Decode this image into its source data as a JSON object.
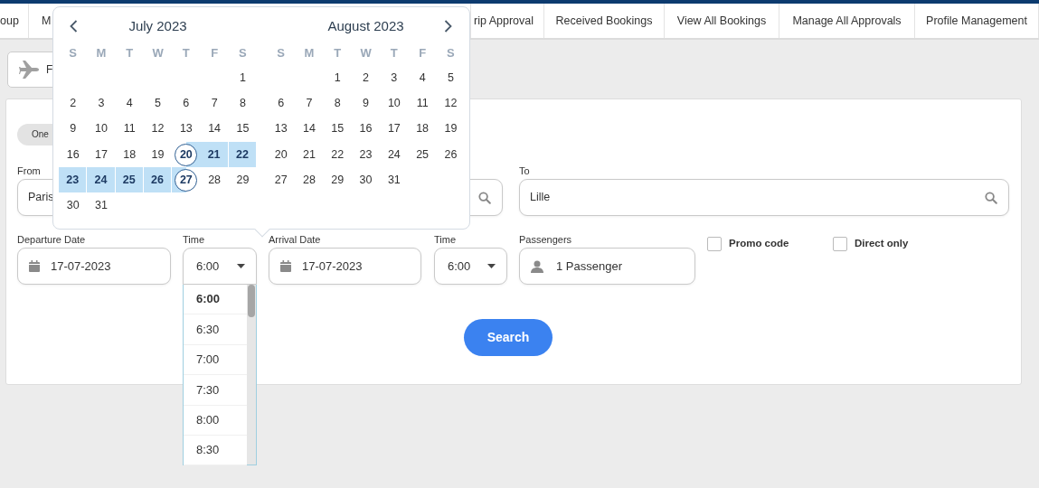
{
  "nav_tabs": [
    "oup",
    "M",
    "rip Approval",
    "Received Bookings",
    "View All Bookings",
    "Manage All Approvals",
    "Profile Management"
  ],
  "mode_button": {
    "label": "F"
  },
  "trip_type": {
    "label": "One"
  },
  "from": {
    "label": "From",
    "value": "Paris"
  },
  "to": {
    "label": "To",
    "value": "Lille"
  },
  "departure_date": {
    "label": "Departure Date",
    "value": "17-07-2023"
  },
  "departure_time": {
    "label": "Time",
    "value": "6:00",
    "open": true
  },
  "arrival_date": {
    "label": "Arrival Date",
    "value": "17-07-2023"
  },
  "arrival_time": {
    "label": "Time",
    "value": "6:00",
    "open": false
  },
  "passengers": {
    "label": "Passengers",
    "value": "1 Passenger"
  },
  "options": [
    {
      "label": "Promo code",
      "checked": false
    },
    {
      "label": "Direct only",
      "checked": false
    }
  ],
  "search_button": "Search",
  "time_options": [
    {
      "label": "6:00",
      "selected": true
    },
    {
      "label": "6:30",
      "selected": false
    },
    {
      "label": "7:00",
      "selected": false
    },
    {
      "label": "7:30",
      "selected": false
    },
    {
      "label": "8:00",
      "selected": false
    },
    {
      "label": "8:30",
      "selected": false
    }
  ],
  "calendar": {
    "months": [
      {
        "title": "July 2023",
        "weekdays": [
          "S",
          "M",
          "T",
          "W",
          "T",
          "F",
          "S"
        ],
        "weeks": [
          [
            {
              "label": "1",
              "selected": false,
              "in_range": false
            }
          ],
          [
            {
              "label": "2",
              "selected": false,
              "in_range": false
            },
            {
              "label": "3",
              "selected": false,
              "in_range": false
            },
            {
              "label": "4",
              "selected": false,
              "in_range": false
            },
            {
              "label": "5",
              "selected": false,
              "in_range": false
            },
            {
              "label": "6",
              "selected": false,
              "in_range": false
            },
            {
              "label": "7",
              "selected": false,
              "in_range": false
            },
            {
              "label": "8",
              "selected": false,
              "in_range": false
            }
          ],
          [
            {
              "label": "9",
              "selected": false,
              "in_range": false
            },
            {
              "label": "10",
              "selected": false,
              "in_range": false
            },
            {
              "label": "11",
              "selected": false,
              "in_range": false
            },
            {
              "label": "12",
              "selected": false,
              "in_range": false
            },
            {
              "label": "13",
              "selected": false,
              "in_range": false
            },
            {
              "label": "14",
              "selected": false,
              "in_range": false
            },
            {
              "label": "15",
              "selected": false,
              "in_range": false
            }
          ],
          [
            {
              "label": "16",
              "selected": false,
              "in_range": false
            },
            {
              "label": "17",
              "selected": false,
              "in_range": false
            },
            {
              "label": "18",
              "selected": false,
              "in_range": false
            },
            {
              "label": "19",
              "selected": false,
              "in_range": false
            },
            {
              "label": "20",
              "selected": true,
              "in_range": false
            },
            {
              "label": "21",
              "selected": false,
              "in_range": true
            },
            {
              "label": "22",
              "selected": false,
              "in_range": true
            }
          ],
          [
            {
              "label": "23",
              "selected": false,
              "in_range": true
            },
            {
              "label": "24",
              "selected": false,
              "in_range": true
            },
            {
              "label": "25",
              "selected": false,
              "in_range": true
            },
            {
              "label": "26",
              "selected": false,
              "in_range": true
            },
            {
              "label": "27",
              "selected": true,
              "in_range": false
            },
            {
              "label": "28",
              "selected": false,
              "in_range": false
            },
            {
              "label": "29",
              "selected": false,
              "in_range": false
            }
          ],
          [
            {
              "label": "30",
              "selected": false,
              "in_range": false
            },
            {
              "label": "31",
              "selected": false,
              "in_range": false
            }
          ]
        ]
      },
      {
        "title": "August 2023",
        "weekdays": [
          "S",
          "M",
          "T",
          "W",
          "T",
          "F",
          "S"
        ],
        "weeks": [
          [
            {
              "label": "1",
              "selected": false,
              "in_range": false
            },
            {
              "label": "2",
              "selected": false,
              "in_range": false
            },
            {
              "label": "3",
              "selected": false,
              "in_range": false
            },
            {
              "label": "4",
              "selected": false,
              "in_range": false
            },
            {
              "label": "5",
              "selected": false,
              "in_range": false
            }
          ],
          [
            {
              "label": "6",
              "selected": false,
              "in_range": false
            },
            {
              "label": "7",
              "selected": false,
              "in_range": false
            },
            {
              "label": "8",
              "selected": false,
              "in_range": false
            },
            {
              "label": "9",
              "selected": false,
              "in_range": false
            },
            {
              "label": "10",
              "selected": false,
              "in_range": false
            },
            {
              "label": "11",
              "selected": false,
              "in_range": false
            },
            {
              "label": "12",
              "selected": false,
              "in_range": false
            }
          ],
          [
            {
              "label": "13",
              "selected": false,
              "in_range": false
            },
            {
              "label": "14",
              "selected": false,
              "in_range": false
            },
            {
              "label": "15",
              "selected": false,
              "in_range": false
            },
            {
              "label": "16",
              "selected": false,
              "in_range": false
            },
            {
              "label": "17",
              "selected": false,
              "in_range": false
            },
            {
              "label": "18",
              "selected": false,
              "in_range": false
            },
            {
              "label": "19",
              "selected": false,
              "in_range": false
            }
          ],
          [
            {
              "label": "20",
              "selected": false,
              "in_range": false
            },
            {
              "label": "21",
              "selected": false,
              "in_range": false
            },
            {
              "label": "22",
              "selected": false,
              "in_range": false
            },
            {
              "label": "23",
              "selected": false,
              "in_range": false
            },
            {
              "label": "24",
              "selected": false,
              "in_range": false
            },
            {
              "label": "25",
              "selected": false,
              "in_range": false
            },
            {
              "label": "26",
              "selected": false,
              "in_range": false
            }
          ],
          [
            {
              "label": "27",
              "selected": false,
              "in_range": false
            },
            {
              "label": "28",
              "selected": false,
              "in_range": false
            },
            {
              "label": "29",
              "selected": false,
              "in_range": false
            },
            {
              "label": "30",
              "selected": false,
              "in_range": false
            },
            {
              "label": "31",
              "selected": false,
              "in_range": false
            }
          ]
        ]
      }
    ]
  }
}
